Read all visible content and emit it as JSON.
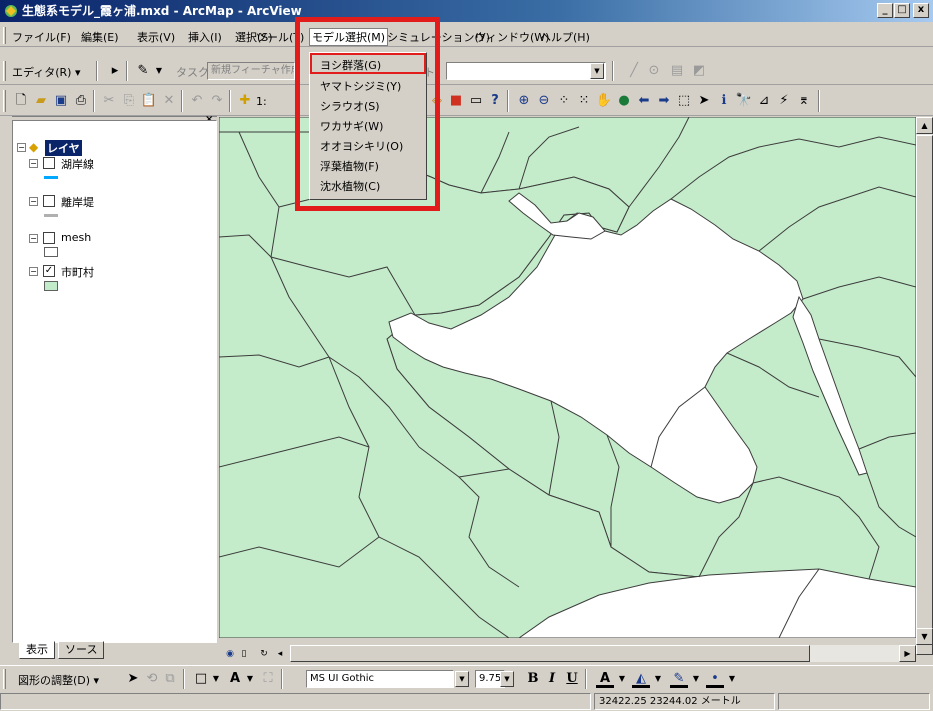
{
  "window": {
    "title": "生態系モデル_霞ヶ浦.mxd - ArcMap - ArcView",
    "min": "_",
    "max": "□",
    "close": "x"
  },
  "menubar": [
    "ファイル(F)",
    "編集(E)",
    "表示(V)",
    "挿入(I)",
    "選択(S)",
    "ツール(T)",
    "モデル選択(M)",
    "シミュレーション(Y)",
    "ウィンドウ(W)",
    "ヘルプ(H)"
  ],
  "editor": {
    "editor_menu": "エディタ(R) ▾",
    "task_label": "タスク",
    "task_value": "新規フィーチャ作成",
    "target_label": "ターゲット:",
    "target_value": ""
  },
  "standard": {
    "scale_prefix": "1:"
  },
  "dropdown": {
    "items": [
      "ヨシ群落(G)",
      "ヤマトシジミ(Y)",
      "シラウオ(S)",
      "ワカサギ(W)",
      "オオヨシキリ(O)",
      "浮葉植物(F)",
      "沈水植物(C)"
    ],
    "highlighted": "ヨシ群落(G)"
  },
  "toc": {
    "root_label": "レイヤ",
    "layers": [
      {
        "name": "湖岸線",
        "checked": false,
        "symbol": "line",
        "color": "#00a8ff"
      },
      {
        "name": "離岸堤",
        "checked": false,
        "symbol": "line",
        "color": "#b0b0b0"
      },
      {
        "name": "mesh",
        "checked": false,
        "symbol": "box",
        "color": "#ffffff"
      },
      {
        "name": "市町村",
        "checked": true,
        "symbol": "box",
        "color": "#c2ecc9"
      }
    ],
    "tabs": [
      "表示",
      "ソース"
    ]
  },
  "drawing": {
    "adjust_label": "図形の調整(D) ▾",
    "font_name": "MS UI Gothic",
    "font_size": "9.75",
    "bold": "B",
    "italic": "I",
    "underline": "U"
  },
  "status": {
    "coords": "32422.25  23244.02 メートル"
  },
  "colors": {
    "land": "#c4ecca",
    "water": "#ffffff",
    "boundary": "#3c3c3c",
    "highlight": "#e21b1b"
  }
}
